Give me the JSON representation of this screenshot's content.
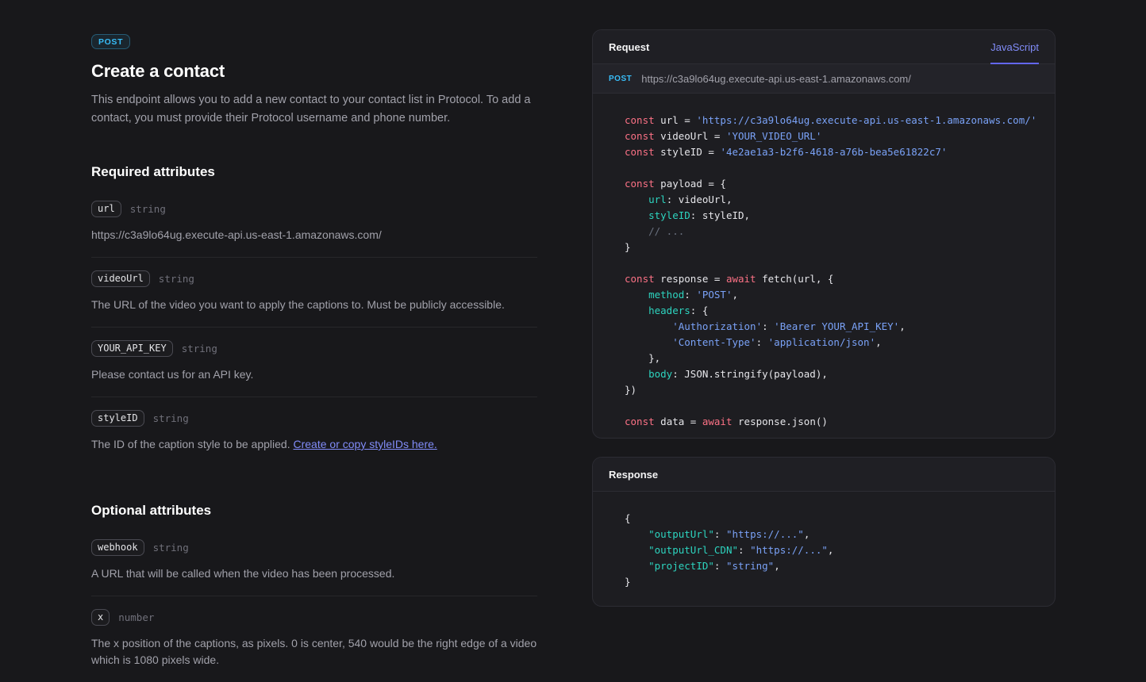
{
  "colors": {
    "page_bg": "#18181b",
    "method_badge": "#38bdf8",
    "tab_accent": "#6366f1",
    "link": "#818cf8",
    "syntax_keyword": "#fb7185",
    "syntax_string": "#7aa2f7",
    "syntax_property": "#2dd4bf",
    "syntax_comment": "#6b7280"
  },
  "article": {
    "method_badge": "POST",
    "title": "Create a contact",
    "intro": "This endpoint allows you to add a new contact to your contact list in Protocol. To add a contact, you must provide their Protocol username and phone number.",
    "sections": [
      {
        "heading": "Required attributes",
        "attributes": [
          {
            "name": "url",
            "type": "string",
            "description": "https://c3a9lo64ug.execute-api.us-east-1.amazonaws.com/"
          },
          {
            "name": "videoUrl",
            "type": "string",
            "description": "The URL of the video you want to apply the captions to. Must be publicly accessible."
          },
          {
            "name": "YOUR_API_KEY",
            "type": "string",
            "description": "Please contact us for an API key."
          },
          {
            "name": "styleID",
            "type": "string",
            "description": "The ID of the caption style to be applied.",
            "link": "Create or copy styleIDs here."
          }
        ]
      },
      {
        "heading": "Optional attributes",
        "attributes": [
          {
            "name": "webhook",
            "type": "string",
            "description": "A URL that will be called when the video has been processed."
          },
          {
            "name": "x",
            "type": "number",
            "description": "The x position of the captions, as pixels. 0 is center, 540 would be the right edge of a video which is 1080 pixels wide."
          }
        ]
      }
    ]
  },
  "request_panel": {
    "title": "Request",
    "tab": "JavaScript",
    "method": "POST",
    "url": "https://c3a9lo64ug.execute-api.us-east-1.amazonaws.com/",
    "code": [
      [
        [
          "kw",
          "const"
        ],
        [
          "pl",
          " url = "
        ],
        [
          "str",
          "'https://c3a9lo64ug.execute-api.us-east-1.amazonaws.com/'"
        ]
      ],
      [
        [
          "kw",
          "const"
        ],
        [
          "pl",
          " videoUrl = "
        ],
        [
          "str",
          "'YOUR_VIDEO_URL'"
        ]
      ],
      [
        [
          "kw",
          "const"
        ],
        [
          "pl",
          " styleID = "
        ],
        [
          "str",
          "'4e2ae1a3-b2f6-4618-a76b-bea5e61822c7'"
        ]
      ],
      [],
      [
        [
          "kw",
          "const"
        ],
        [
          "pl",
          " payload = {"
        ]
      ],
      [
        [
          "pl",
          "    "
        ],
        [
          "prop",
          "url"
        ],
        [
          "pl",
          ": videoUrl,"
        ]
      ],
      [
        [
          "pl",
          "    "
        ],
        [
          "prop",
          "styleID"
        ],
        [
          "pl",
          ": styleID,"
        ]
      ],
      [
        [
          "pl",
          "    "
        ],
        [
          "com",
          "// ..."
        ]
      ],
      [
        [
          "pl",
          "}"
        ]
      ],
      [],
      [
        [
          "kw",
          "const"
        ],
        [
          "pl",
          " response = "
        ],
        [
          "kw",
          "await"
        ],
        [
          "pl",
          " fetch(url, {"
        ]
      ],
      [
        [
          "pl",
          "    "
        ],
        [
          "prop",
          "method"
        ],
        [
          "pl",
          ": "
        ],
        [
          "str",
          "'POST'"
        ],
        [
          "pl",
          ","
        ]
      ],
      [
        [
          "pl",
          "    "
        ],
        [
          "prop",
          "headers"
        ],
        [
          "pl",
          ": {"
        ]
      ],
      [
        [
          "pl",
          "        "
        ],
        [
          "str",
          "'Authorization'"
        ],
        [
          "pl",
          ": "
        ],
        [
          "str",
          "'Bearer YOUR_API_KEY'"
        ],
        [
          "pl",
          ","
        ]
      ],
      [
        [
          "pl",
          "        "
        ],
        [
          "str",
          "'Content-Type'"
        ],
        [
          "pl",
          ": "
        ],
        [
          "str",
          "'application/json'"
        ],
        [
          "pl",
          ","
        ]
      ],
      [
        [
          "pl",
          "    },"
        ]
      ],
      [
        [
          "pl",
          "    "
        ],
        [
          "prop",
          "body"
        ],
        [
          "pl",
          ": JSON.stringify(payload),"
        ]
      ],
      [
        [
          "pl",
          "})"
        ]
      ],
      [],
      [
        [
          "kw",
          "const"
        ],
        [
          "pl",
          " data = "
        ],
        [
          "kw",
          "await"
        ],
        [
          "pl",
          " response.json()"
        ]
      ]
    ]
  },
  "response_panel": {
    "title": "Response",
    "code": [
      [
        [
          "pl",
          "{"
        ]
      ],
      [
        [
          "pl",
          "    "
        ],
        [
          "prop",
          "\"outputUrl\""
        ],
        [
          "pl",
          ": "
        ],
        [
          "str",
          "\"https://...\""
        ],
        [
          "pl",
          ","
        ]
      ],
      [
        [
          "pl",
          "    "
        ],
        [
          "prop",
          "\"outputUrl_CDN\""
        ],
        [
          "pl",
          ": "
        ],
        [
          "str",
          "\"https://...\""
        ],
        [
          "pl",
          ","
        ]
      ],
      [
        [
          "pl",
          "    "
        ],
        [
          "prop",
          "\"projectID\""
        ],
        [
          "pl",
          ": "
        ],
        [
          "str",
          "\"string\""
        ],
        [
          "pl",
          ","
        ]
      ],
      [
        [
          "pl",
          "}"
        ]
      ]
    ]
  }
}
